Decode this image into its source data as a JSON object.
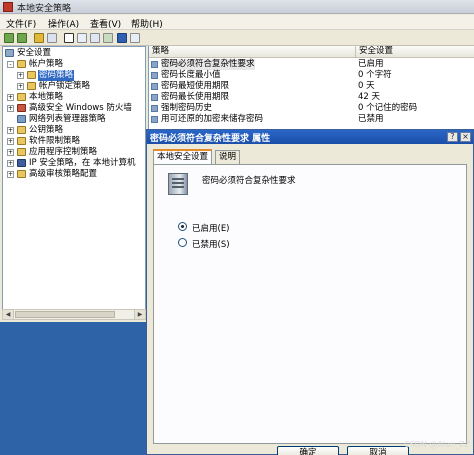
{
  "window": {
    "title": "本地安全策略"
  },
  "menu": [
    "文件(F)",
    "操作(A)",
    "查看(V)",
    "帮助(H)"
  ],
  "tree": {
    "root": "安全设置",
    "items": [
      {
        "label": "帐户策略",
        "level": 1,
        "expand": "-"
      },
      {
        "label": "密码策略",
        "level": 2,
        "expand": "+",
        "selected": true
      },
      {
        "label": "帐户锁定策略",
        "level": 2,
        "expand": "+"
      },
      {
        "label": "本地策略",
        "level": 1,
        "expand": "+"
      },
      {
        "label": "高级安全 Windows 防火墙",
        "level": 1,
        "expand": "+"
      },
      {
        "label": "网络列表管理器策略",
        "level": 1,
        "expand": ""
      },
      {
        "label": "公钥策略",
        "level": 1,
        "expand": "+"
      },
      {
        "label": "软件限制策略",
        "level": 1,
        "expand": "+"
      },
      {
        "label": "应用程序控制策略",
        "level": 1,
        "expand": "+"
      },
      {
        "label": "IP 安全策略，在 本地计算机",
        "level": 1,
        "expand": "+"
      },
      {
        "label": "高级审核策略配置",
        "level": 1,
        "expand": "+"
      }
    ]
  },
  "list": {
    "headers": {
      "policy": "策略",
      "setting": "安全设置"
    },
    "rows": [
      {
        "name": "密码必须符合复杂性要求",
        "value": "已启用"
      },
      {
        "name": "密码长度最小值",
        "value": "0 个字符"
      },
      {
        "name": "密码最短使用期限",
        "value": "0 天"
      },
      {
        "name": "密码最长使用期限",
        "value": "42 天"
      },
      {
        "name": "强制密码历史",
        "value": "0 个记住的密码"
      },
      {
        "name": "用可还原的加密来储存密码",
        "value": "已禁用"
      }
    ]
  },
  "dialog": {
    "title": "密码必须符合复杂性要求 属性",
    "tabs": [
      "本地安全设置",
      "说明"
    ],
    "policy_name": "密码必须符合复杂性要求",
    "enabled_label": "已启用(E)",
    "disabled_label": "已禁用(S)",
    "ok_label": "确定",
    "cancel_label": "取消"
  },
  "watermark": "CSDN @Alan_ZZ"
}
